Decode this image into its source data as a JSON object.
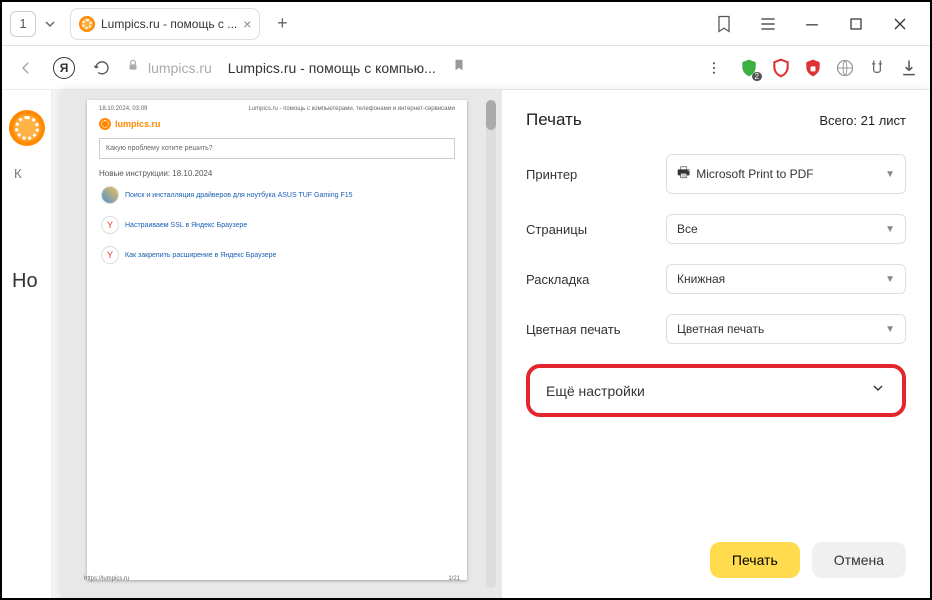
{
  "titlebar": {
    "tab_count": "1",
    "tab_title": "Lumpics.ru - помощь с ...",
    "close_glyph": "×",
    "plus_glyph": "+"
  },
  "addressbar": {
    "domain": "lumpics.ru",
    "page_title": "Lumpics.ru - помощь с компью...",
    "ext_badge": "2"
  },
  "background": {
    "heading_fragment": "Но",
    "letter_k": "К"
  },
  "preview": {
    "date": "18.10.2024, 03:09",
    "header_right": "Lumpics.ru - помощь с компьютерами, телефонами и интернет-сервисами",
    "logo_text": "lumpics.ru",
    "search_placeholder": "Какую проблему хотите решить?",
    "section": "Новые инструкции: 18.10.2024",
    "items": [
      "Поиск и инсталляция драйверов для ноутбука ASUS TUF Gaming F15",
      "Настраиваем SSL в Яндекс Браузере",
      "Как закрепить расширение в Яндекс Браузере"
    ],
    "footer_left": "https://lumpics.ru",
    "footer_right": "1/21"
  },
  "print": {
    "title": "Печать",
    "total": "Всего: 21 лист",
    "printer_label": "Принтер",
    "printer_value": "Microsoft Print to PDF",
    "pages_label": "Страницы",
    "pages_value": "Все",
    "layout_label": "Раскладка",
    "layout_value": "Книжная",
    "color_label": "Цветная печать",
    "color_value": "Цветная печать",
    "more_settings": "Ещё настройки",
    "print_btn": "Печать",
    "cancel_btn": "Отмена"
  }
}
